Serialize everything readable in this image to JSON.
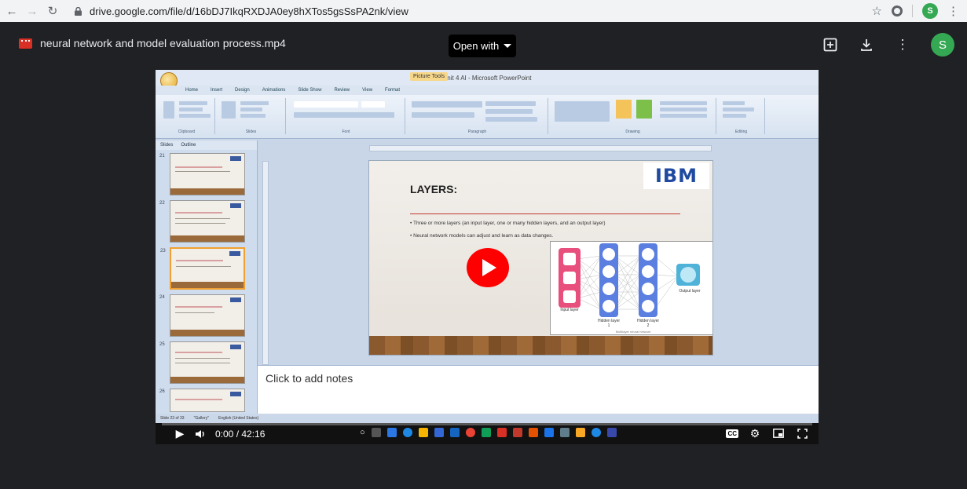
{
  "browser": {
    "url": "drive.google.com/file/d/16bDJ7IkqRXDJA0ey8hXTos5gsSsPA2nk/view",
    "profile_initial": "S"
  },
  "drive": {
    "file_name": "neural network and model evaluation process.mp4",
    "open_with_label": "Open with",
    "avatar_initial": "S"
  },
  "ppt": {
    "window_title": "Unit 4 AI - Microsoft PowerPoint",
    "context_tab": "Picture Tools",
    "ribbon_tabs": [
      "Home",
      "Insert",
      "Design",
      "Animations",
      "Slide Show",
      "Review",
      "View",
      "Format"
    ],
    "ribbon_groups": [
      "Clipboard",
      "Slides",
      "Font",
      "Paragraph",
      "Drawing",
      "Editing"
    ],
    "pane_tabs": [
      "Slides",
      "Outline"
    ],
    "thumb_numbers": [
      "21",
      "22",
      "23",
      "24",
      "25",
      "26"
    ],
    "slide": {
      "title": "LAYERS:",
      "bullets": [
        "Three or more layers (an input layer, one or many hidden layers, and an output layer)",
        "Neural network models can adjust and learn as data changes."
      ],
      "logo": "IBM",
      "nn_labels": {
        "input": "Input layer",
        "hidden1": "Hidden layer 1",
        "hidden2": "Hidden layer 2",
        "output": "Output layer",
        "caption": "Multilayer neural network"
      }
    },
    "notes_placeholder": "Click to add notes",
    "status_items": [
      "Slide 23 of 33",
      "\"Gallery\"",
      "English (United States)"
    ]
  },
  "player": {
    "time": "0:00 / 42:16",
    "progress": 0.0,
    "cc_label": "CC"
  },
  "colors": {
    "play_button": "#ff0000",
    "progress": "#ff0000",
    "drive_bg": "#202124"
  }
}
